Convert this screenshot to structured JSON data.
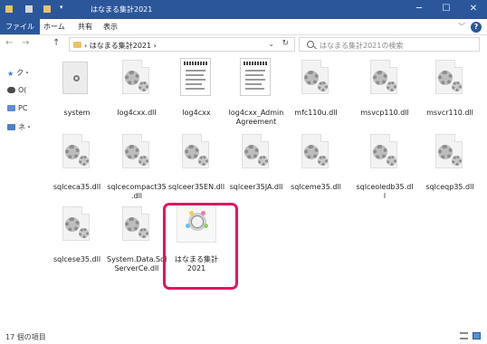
{
  "window": {
    "title": "はなまる集計2021",
    "minimize_glyph": "─",
    "maximize_glyph": "☐",
    "close_glyph": "✕",
    "titlebar_color": "#2b579a"
  },
  "ribbon": {
    "tabs": [
      "ファイル",
      "ホーム",
      "共有",
      "表示"
    ],
    "active_tab": "ファイル",
    "expand_glyph": "﹀",
    "help_glyph": "?"
  },
  "address_bar": {
    "back_glyph": "←",
    "forward_glyph": "→",
    "up_glyph": "↑",
    "path": "›  はなまる集計2021  ›",
    "dropdown_glyph": "⌄",
    "refresh_glyph": "↻"
  },
  "search": {
    "placeholder": "はなまる集計2021の検索"
  },
  "nav_pane": {
    "items": [
      {
        "label": "ク・",
        "icon": "star-icon"
      },
      {
        "label": "O(",
        "icon": "cloud-icon"
      },
      {
        "label": "PC",
        "icon": "pc-icon"
      },
      {
        "label": "ネ・",
        "icon": "network-icon"
      }
    ]
  },
  "files": [
    {
      "name": "system",
      "icon": "folder-icon",
      "kind": "folder"
    },
    {
      "name": "log4cxx.dll",
      "icon": "dll-icon",
      "kind": "dll"
    },
    {
      "name": "log4cxx",
      "icon": "text-file-icon",
      "kind": "text"
    },
    {
      "name": "log4cxx_Admin\nAgreement",
      "icon": "text-file-icon",
      "kind": "text"
    },
    {
      "name": "mfc110u.dll",
      "icon": "dll-icon",
      "kind": "dll"
    },
    {
      "name": "msvcp110.dll",
      "icon": "dll-icon",
      "kind": "dll"
    },
    {
      "name": "msvcr110.dll",
      "icon": "dll-icon",
      "kind": "dll"
    },
    {
      "name": "sqlceca35.dll",
      "icon": "dll-icon",
      "kind": "dll"
    },
    {
      "name": "sqlcecompact35\n.dll",
      "icon": "dll-icon",
      "kind": "dll"
    },
    {
      "name": "sqlceer35EN.dll",
      "icon": "dll-icon",
      "kind": "dll"
    },
    {
      "name": "sqlceer35JA.dll",
      "icon": "dll-icon",
      "kind": "dll"
    },
    {
      "name": "sqlceme35.dll",
      "icon": "dll-icon",
      "kind": "dll"
    },
    {
      "name": "sqlceoledb35.dl\nl",
      "icon": "dll-icon",
      "kind": "dll"
    },
    {
      "name": "sqlceqp35.dll",
      "icon": "dll-icon",
      "kind": "dll"
    },
    {
      "name": "sqlcese35.dll",
      "icon": "dll-icon",
      "kind": "dll"
    },
    {
      "name": "System.Data.Sql\nServerCe.dll",
      "icon": "dll-icon",
      "kind": "dll"
    },
    {
      "name": "はなまる集計\n2021",
      "icon": "app-icon",
      "kind": "app",
      "highlighted": true
    }
  ],
  "status_bar": {
    "item_count": "17 個の項目"
  },
  "colors": {
    "accent": "#2b579a",
    "highlight": "#e2155f"
  }
}
